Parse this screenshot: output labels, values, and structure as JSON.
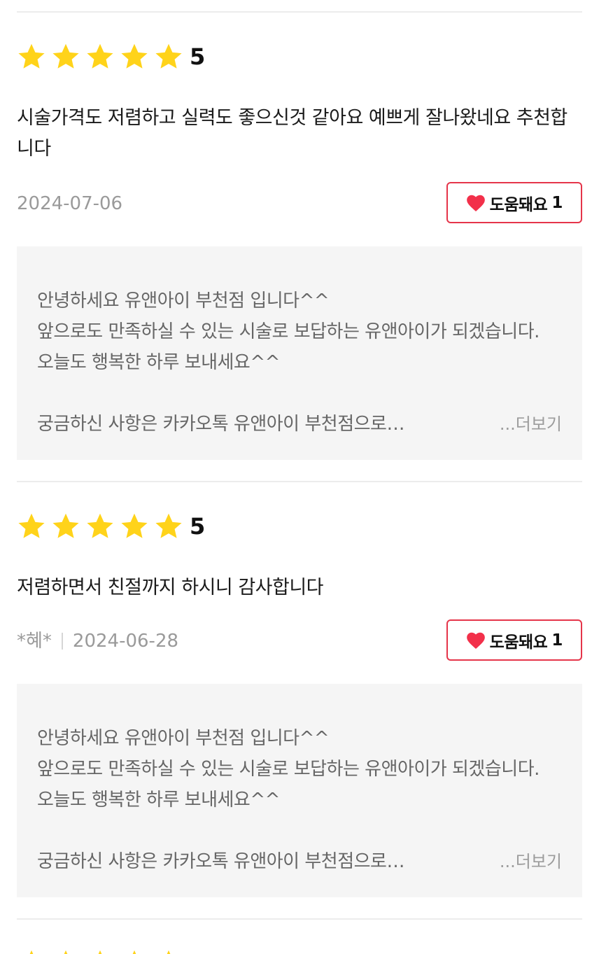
{
  "reviews": [
    {
      "rating": "5",
      "text": "시술가격도 저렴하고 실력도 좋으신것 같아요 예쁘게 잘나왔네요 추천합니다",
      "author": "",
      "date": "2024-07-06",
      "helpful_label": "도움돼요",
      "helpful_count": "1",
      "reply": {
        "lines": "안녕하세요 유앤아이 부천점 입니다^^\n앞으로도 만족하실 수 있는 시술로 보답하는 유앤아이가 되겠습니다.\n오늘도 행복한 하루 보내세요^^",
        "last_line": "궁금하신 사항은 카카오톡 유앤아이 부천점으로…",
        "more_label": "...더보기"
      }
    },
    {
      "rating": "5",
      "text": "저렴하면서 친절까지 하시니 감사합니다",
      "author": "*혜*",
      "date": "2024-06-28",
      "helpful_label": "도움돼요",
      "helpful_count": "1",
      "reply": {
        "lines": "안녕하세요 유앤아이 부천점 입니다^^\n앞으로도 만족하실 수 있는 시술로 보답하는 유앤아이가 되겠습니다.\n오늘도 행복한 하루 보내세요^^",
        "last_line": "궁금하신 사항은 카카오톡 유앤아이 부천점으로…",
        "more_label": "...더보기"
      }
    }
  ],
  "colors": {
    "star": "#ffd31a",
    "heart": "#f2304a",
    "button_border": "#e5354a",
    "reply_bg": "#f5f5f5"
  },
  "icons": {
    "star": "star-icon",
    "heart": "heart-icon"
  }
}
